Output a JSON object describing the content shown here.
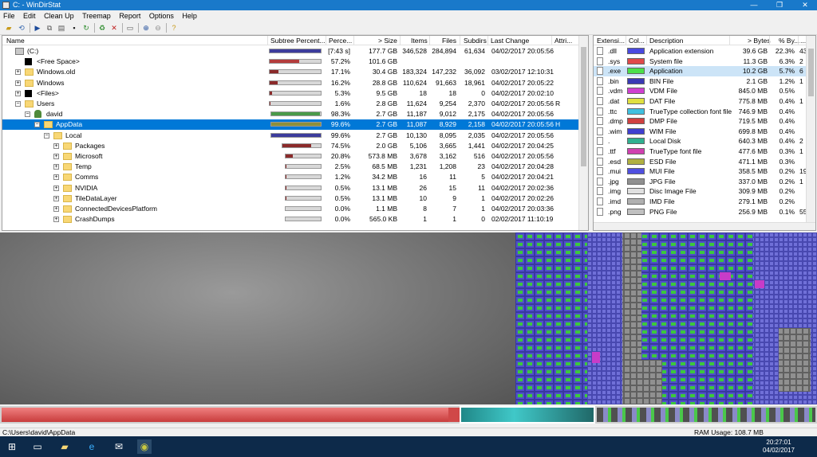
{
  "window": {
    "title": "C: - WinDirStat"
  },
  "menu": [
    "File",
    "Edit",
    "Clean Up",
    "Treemap",
    "Report",
    "Options",
    "Help"
  ],
  "tree": {
    "headers": [
      "Name",
      "Subtree Percent...",
      "Perce...",
      "> Size",
      "Items",
      "Files",
      "Subdirs",
      "Last Change",
      "Attri..."
    ],
    "rows": [
      {
        "name": "(C:)",
        "pct": "[7:43 s]",
        "size": "177.7 GB",
        "items": "346,528",
        "files": "284,894",
        "subdirs": "61,634",
        "date": "04/02/2017  20:05:56",
        "attr": "",
        "bar": 1.0,
        "color": "#3c3c9c"
      },
      {
        "name": "<Free Space>",
        "pct": "57.2%",
        "size": "101.6 GB",
        "items": "",
        "files": "",
        "subdirs": "",
        "date": "",
        "attr": "",
        "bar": 0.572,
        "color": "#b43c3c"
      },
      {
        "name": "Windows.old",
        "pct": "17.1%",
        "size": "30.4 GB",
        "items": "183,324",
        "files": "147,232",
        "subdirs": "36,092",
        "date": "03/02/2017  12:10:31",
        "attr": "",
        "bar": 0.171,
        "color": "#8b2a2a"
      },
      {
        "name": "Windows",
        "pct": "16.2%",
        "size": "28.8 GB",
        "items": "110,624",
        "files": "91,663",
        "subdirs": "18,961",
        "date": "04/02/2017  20:05:22",
        "attr": "",
        "bar": 0.162,
        "color": "#8b2a2a"
      },
      {
        "name": "<Files>",
        "pct": "5.3%",
        "size": "9.5 GB",
        "items": "18",
        "files": "18",
        "subdirs": "0",
        "date": "04/02/2017  20:02:10",
        "attr": "",
        "bar": 0.053,
        "color": "#8b2a2a"
      },
      {
        "name": "Users",
        "pct": "1.6%",
        "size": "2.8 GB",
        "items": "11,624",
        "files": "9,254",
        "subdirs": "2,370",
        "date": "04/02/2017  20:05:56",
        "attr": "R",
        "bar": 0.016,
        "color": "#8b2a2a"
      },
      {
        "name": "david",
        "pct": "98.3%",
        "size": "2.7 GB",
        "items": "11,187",
        "files": "9,012",
        "subdirs": "2,175",
        "date": "04/02/2017  20:05:56",
        "attr": "",
        "bar": 0.983,
        "color": "#4a9a4a"
      },
      {
        "name": "AppData",
        "pct": "99.6%",
        "size": "2.7 GB",
        "items": "11,087",
        "files": "8,929",
        "subdirs": "2,158",
        "date": "04/02/2017  20:05:56",
        "attr": "H",
        "bar": 0.996,
        "color": "#8f8f3a"
      },
      {
        "name": "Local",
        "pct": "99.6%",
        "size": "2.7 GB",
        "items": "10,130",
        "files": "8,095",
        "subdirs": "2,035",
        "date": "04/02/2017  20:05:56",
        "attr": "",
        "bar": 0.996,
        "color": "#3c3c9c"
      },
      {
        "name": "Packages",
        "pct": "74.5%",
        "size": "2.0 GB",
        "items": "5,106",
        "files": "3,665",
        "subdirs": "1,441",
        "date": "04/02/2017  20:04:25",
        "attr": "",
        "bar": 0.745,
        "color": "#8b2a2a"
      },
      {
        "name": "Microsoft",
        "pct": "20.8%",
        "size": "573.8 MB",
        "items": "3,678",
        "files": "3,162",
        "subdirs": "516",
        "date": "04/02/2017  20:05:56",
        "attr": "",
        "bar": 0.208,
        "color": "#8b2a2a"
      },
      {
        "name": "Temp",
        "pct": "2.5%",
        "size": "68.5 MB",
        "items": "1,231",
        "files": "1,208",
        "subdirs": "23",
        "date": "04/02/2017  20:04:28",
        "attr": "",
        "bar": 0.025,
        "color": "#8b2a2a"
      },
      {
        "name": "Comms",
        "pct": "1.2%",
        "size": "34.2 MB",
        "items": "16",
        "files": "11",
        "subdirs": "5",
        "date": "04/02/2017  20:04:21",
        "attr": "",
        "bar": 0.012,
        "color": "#8b2a2a"
      },
      {
        "name": "NVIDIA",
        "pct": "0.5%",
        "size": "13.1 MB",
        "items": "26",
        "files": "15",
        "subdirs": "11",
        "date": "04/02/2017  20:02:36",
        "attr": "",
        "bar": 0.005,
        "color": "#8b2a2a"
      },
      {
        "name": "TileDataLayer",
        "pct": "0.5%",
        "size": "13.1 MB",
        "items": "10",
        "files": "9",
        "subdirs": "1",
        "date": "04/02/2017  20:02:26",
        "attr": "",
        "bar": 0.005,
        "color": "#8b2a2a"
      },
      {
        "name": "ConnectedDevicesPlatform",
        "pct": "0.0%",
        "size": "1.1 MB",
        "items": "8",
        "files": "7",
        "subdirs": "1",
        "date": "04/02/2017  20:03:36",
        "attr": "",
        "bar": 0.0,
        "color": "#8b2a2a"
      },
      {
        "name": "CrashDumps",
        "pct": "0.0%",
        "size": "565.0 KB",
        "items": "1",
        "files": "1",
        "subdirs": "0",
        "date": "02/02/2017  11:10:19",
        "attr": "",
        "bar": 0.0,
        "color": "#8b2a2a"
      }
    ]
  },
  "ext": {
    "headers": [
      "Extensi...",
      "Col...",
      "Description",
      "> Bytes",
      "% By...",
      "..."
    ],
    "rows": [
      {
        "ext": ".dll",
        "color": "#4a4ae0",
        "desc": "Application extension",
        "bytes": "39.6 GB",
        "pct": "22.3%",
        "extra": "43"
      },
      {
        "ext": ".sys",
        "color": "#e04a4a",
        "desc": "System file",
        "bytes": "11.3 GB",
        "pct": "6.3%",
        "extra": "2"
      },
      {
        "ext": ".exe",
        "color": "#4ae04a",
        "desc": "Application",
        "bytes": "10.2 GB",
        "pct": "5.7%",
        "extra": "6"
      },
      {
        "ext": ".bin",
        "color": "#3a3ab4",
        "desc": "BIN File",
        "bytes": "2.1 GB",
        "pct": "1.2%",
        "extra": "1"
      },
      {
        "ext": ".vdm",
        "color": "#d040d0",
        "desc": "VDM File",
        "bytes": "845.0 MB",
        "pct": "0.5%",
        "extra": ""
      },
      {
        "ext": ".dat",
        "color": "#e0e040",
        "desc": "DAT File",
        "bytes": "775.8 MB",
        "pct": "0.4%",
        "extra": "1"
      },
      {
        "ext": ".ttc",
        "color": "#40c0e0",
        "desc": "TrueType collection font file",
        "bytes": "746.9 MB",
        "pct": "0.4%",
        "extra": ""
      },
      {
        "ext": ".dmp",
        "color": "#d04040",
        "desc": "DMP File",
        "bytes": "719.5 MB",
        "pct": "0.4%",
        "extra": ""
      },
      {
        "ext": ".wim",
        "color": "#4040d0",
        "desc": "WIM File",
        "bytes": "699.8 MB",
        "pct": "0.4%",
        "extra": ""
      },
      {
        "ext": ".",
        "color": "#30b090",
        "desc": "Local Disk",
        "bytes": "640.3 MB",
        "pct": "0.4%",
        "extra": "2"
      },
      {
        "ext": ".ttf",
        "color": "#d040b0",
        "desc": "TrueType font file",
        "bytes": "477.6 MB",
        "pct": "0.3%",
        "extra": "1"
      },
      {
        "ext": ".esd",
        "color": "#b0b040",
        "desc": "ESD File",
        "bytes": "471.1 MB",
        "pct": "0.3%",
        "extra": ""
      },
      {
        "ext": ".mui",
        "color": "#5050e0",
        "desc": "MUI File",
        "bytes": "358.5 MB",
        "pct": "0.2%",
        "extra": "19"
      },
      {
        "ext": ".jpg",
        "color": "#909090",
        "desc": "JPG File",
        "bytes": "337.0 MB",
        "pct": "0.2%",
        "extra": "1"
      },
      {
        "ext": ".img",
        "color": "#e0e0e0",
        "desc": "Disc Image File",
        "bytes": "309.9 MB",
        "pct": "0.2%",
        "extra": ""
      },
      {
        "ext": ".imd",
        "color": "#b0b0b0",
        "desc": "IMD File",
        "bytes": "279.1 MB",
        "pct": "0.2%",
        "extra": ""
      },
      {
        "ext": ".png",
        "color": "#c0c0c0",
        "desc": "PNG File",
        "bytes": "256.9 MB",
        "pct": "0.1%",
        "extra": "55"
      }
    ]
  },
  "status": {
    "path": "C:\\Users\\david\\AppData",
    "ram": "RAM Usage:   108.7 MB"
  },
  "clock": {
    "time": "20:27:01",
    "date": "04/02/2017"
  },
  "icons": [
    "window-icon",
    "open-icon",
    "refresh-icon",
    "play-icon",
    "copy-icon",
    "delete-icon",
    "zoom-in-icon",
    "zoom-out-icon",
    "help-icon"
  ]
}
